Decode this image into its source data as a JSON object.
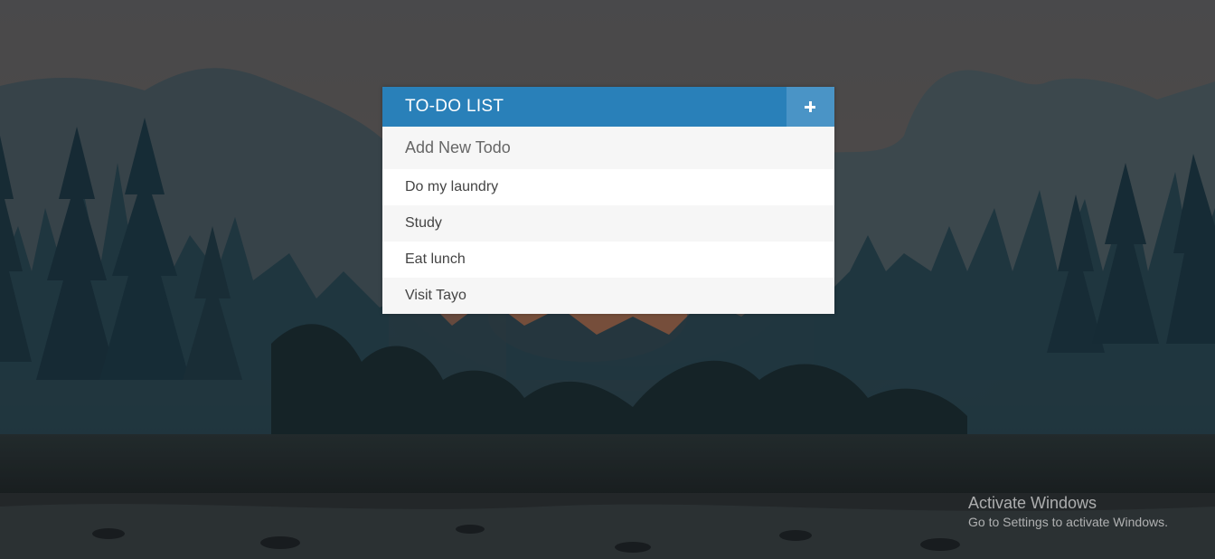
{
  "todo": {
    "title": "TO-DO LIST",
    "toggle_icon": "plus-icon",
    "input_placeholder": "Add New Todo",
    "items": [
      "Do my laundry",
      "Study",
      "Eat lunch",
      "Visit Tayo"
    ]
  },
  "watermark": {
    "title": "Activate Windows",
    "subtitle": "Go to Settings to activate Windows."
  },
  "colors": {
    "header": "#2980b9",
    "toggle_button": "#4a94c6",
    "input_background": "#f6f6f6",
    "stripe": "#f6f6f6"
  }
}
